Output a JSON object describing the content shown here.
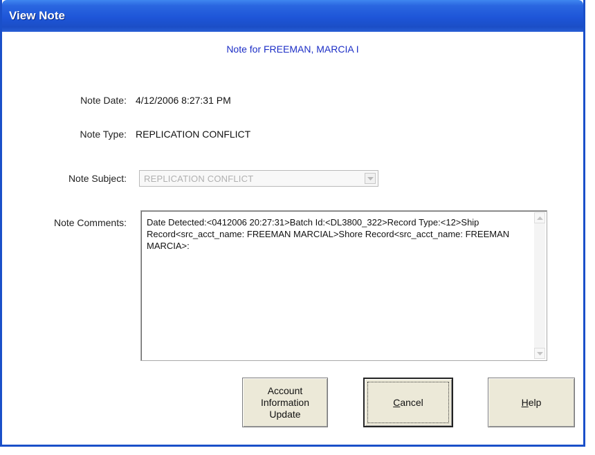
{
  "window": {
    "title": "View Note"
  },
  "header": {
    "text": "Note for FREEMAN, MARCIA I"
  },
  "fields": {
    "note_date_label": "Note Date:",
    "note_date_value": "4/12/2006 8:27:31 PM",
    "note_type_label": "Note Type:",
    "note_type_value": "REPLICATION CONFLICT",
    "note_subject_label": "Note Subject:",
    "note_subject_value": "REPLICATION CONFLICT",
    "note_comments_label": "Note Comments:",
    "note_comments_value": "Date Detected:<0412006 20:27:31>Batch Id:<DL3800_322>Record Type:<12>Ship Record<src_acct_name: FREEMAN MARCIAL>Shore Record<src_acct_name: FREEMAN MARCIA>:"
  },
  "buttons": {
    "account_update_line1": "Account",
    "account_update_line2": "Information",
    "account_update_line3": "Update",
    "cancel_prefix": "",
    "cancel_mnemonic": "C",
    "cancel_rest": "ancel",
    "help_mnemonic": "H",
    "help_rest": "elp"
  },
  "colors": {
    "titlebar": "#1e55d8",
    "header_text": "#1c2ec6",
    "button_face": "#ece9d8",
    "disabled_text": "#b0b0b0"
  },
  "icons": {
    "combo_dropdown": "chevron-down-icon",
    "scroll_up": "arrow-up-icon",
    "scroll_down": "arrow-down-icon"
  }
}
